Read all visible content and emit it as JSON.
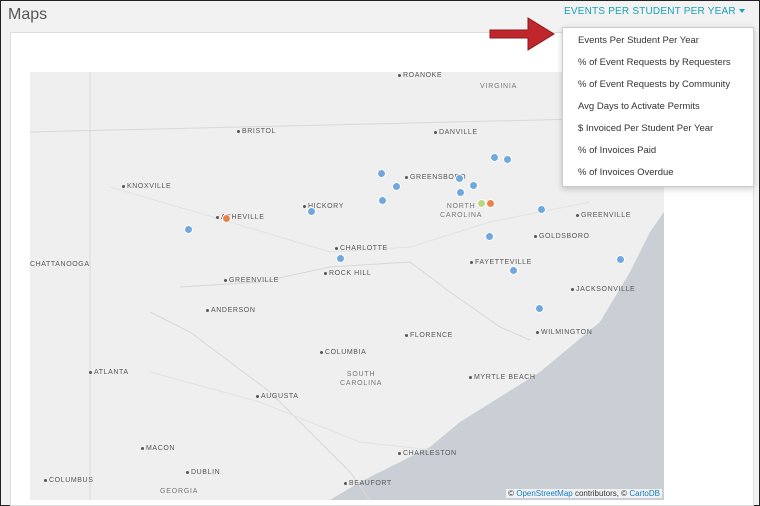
{
  "page": {
    "title": "Maps"
  },
  "dropdown": {
    "selected": "EVENTS PER STUDENT PER YEAR",
    "options": [
      "Events Per Student Per Year",
      "% of Event Requests by Requesters",
      "% of Event Requests by Community",
      "Avg Days to Activate Permits",
      "$ Invoiced Per Student Per Year",
      "% of Invoices Paid",
      "% of Invoices Overdue"
    ]
  },
  "map": {
    "places": [
      "ROANOKE",
      "BRISTOL",
      "DANVILLE",
      "KNOXVILLE",
      "GREENSBORO",
      "HICKORY",
      "ASHEVILLE",
      "GREENVILLE",
      "CHARLOTTE",
      "GOLDSBORO",
      "CHATTANOOGA",
      "ROCK HILL",
      "FAYETTEVILLE",
      "GREENVILLE",
      "JACKSONVILLE",
      "ANDERSON",
      "FLORENCE",
      "WILMINGTON",
      "COLUMBIA",
      "ATLANTA",
      "MYRTLE BEACH",
      "AUGUSTA",
      "CHARLESTON",
      "MACON",
      "DUBLIN",
      "COLUMBUS",
      "BEAUFORT"
    ],
    "regions": [
      "VIRGINIA",
      "NORTH\nCAROLINA",
      "SOUTH\nCAROLINA",
      "GEORGIA"
    ],
    "attribution": {
      "prefix": "© ",
      "osm": "OpenStreetMap",
      "middle": " contributors, © ",
      "carto": "CartoDB"
    },
    "colors": {
      "low": "#6fa8dc",
      "mid": "#b9d77b",
      "high": "#e8844a",
      "water": "#c9cfd4",
      "land": "#efefef"
    }
  }
}
